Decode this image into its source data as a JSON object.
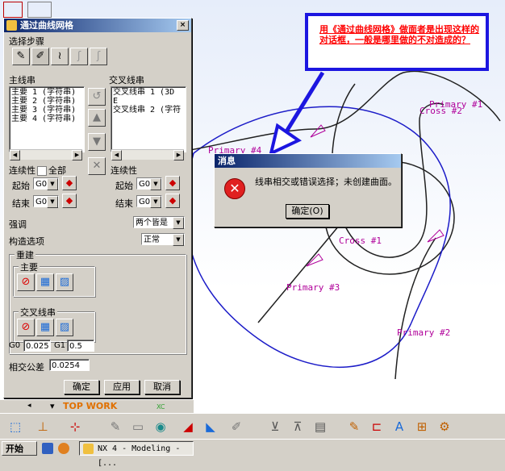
{
  "main_dialog": {
    "title": "通过曲线网格",
    "close_glyph": "×",
    "select_steps_label": "选择步骤",
    "primary_string_label": "主线串",
    "cross_string_label": "交叉线串",
    "primary_items": [
      "主要 1 (字符串)",
      "主要 2 (字符串)",
      "主要 3 (字符串)",
      "主要 4 (字符串)"
    ],
    "cross_items": [
      "交叉线串 1 (3D E",
      "交叉线串 2 (字符"
    ],
    "continuity_label": "连续性",
    "all_label": "全部",
    "start_label": "起始",
    "end_label": "结束",
    "g0_value": "G0",
    "emphasis_label": "强调",
    "emphasis_value": "两个皆是",
    "construct_label": "构造选项",
    "construct_value": "正常",
    "rebuild_label": "重建",
    "rebuild_primary_label": "主要",
    "rebuild_cross_label": "交叉线串",
    "g0_tol_label": "G0",
    "g0_tol_value": "0.025",
    "g1_tol_label": "G1",
    "g1_tol_value": "0.5",
    "intersect_tol_label": "相交公差",
    "intersect_tol_value": "0.0254",
    "ok_button": "确定",
    "apply_button": "应用",
    "cancel_button": "取消"
  },
  "message_dialog": {
    "title": "消息",
    "text": "线串相交或错误选择；未创建曲面。",
    "ok_button": "确定(O)"
  },
  "annotation": {
    "text": "用《通过曲线网格》做面者是出现这样的对话框，一般是哪里做的不对造成的？"
  },
  "viewport": {
    "labels": {
      "primary1": "Primary #1",
      "cross2": "Cross #2",
      "primary4": "Primary #4",
      "cross1": "Cross #1",
      "primary3": "Primary #3",
      "primary2": "Primary #2"
    },
    "status_text": "TOP WORK",
    "axis_label": "XC"
  },
  "taskbar": {
    "start_label": "开始",
    "task_label": "NX 4 - Modeling - [..."
  },
  "colors": {
    "curve_blue": "#1c1cc8",
    "curve_black": "#202020",
    "label_magenta": "#b0009a",
    "annotation_border": "#1c16e0",
    "annotation_text": "#ff0000"
  }
}
